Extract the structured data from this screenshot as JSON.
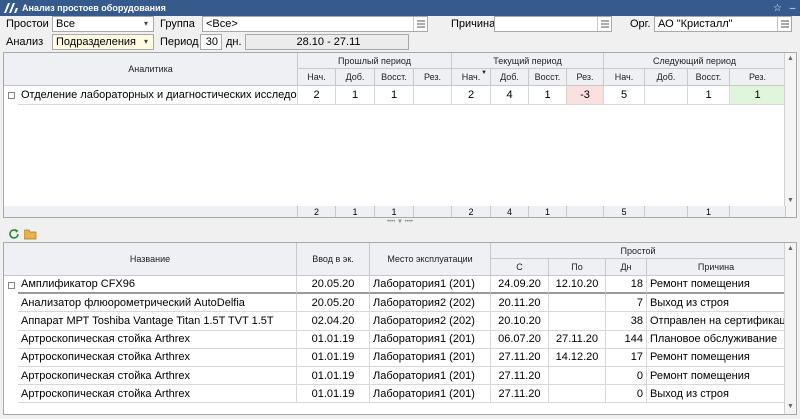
{
  "window": {
    "title": "Анализ простоев оборудования"
  },
  "filters": {
    "downtime_label": "Простои",
    "downtime_value": "Все",
    "group_label": "Группа",
    "group_value": "<Все>",
    "reason_label": "Причина",
    "reason_value": "",
    "org_label": "Орг.",
    "org_value": "АО \"Кристалл\"",
    "analysis_label": "Анализ",
    "analysis_value": "Подразделения",
    "period_label": "Период",
    "period_value": "30",
    "period_unit": "дн.",
    "date_range": "28.10 - 27.11"
  },
  "grid1": {
    "analytics_header": "Аналитика",
    "group_headers": [
      "Прошлый период",
      "Текущий период",
      "Следующий период"
    ],
    "sub_headers": [
      "Нач.",
      "Доб.",
      "Восст.",
      "Рез.",
      "Нач.",
      "Доб.",
      "Восст.",
      "Рез.",
      "Нач.",
      "Доб.",
      "Восст.",
      "Рез."
    ],
    "rows": [
      {
        "name": "Отделение лабораторных и диагностических исследований",
        "values": [
          "2",
          "1",
          "1",
          "",
          "2",
          "4",
          "1",
          "-3",
          "5",
          "",
          "1",
          "1"
        ]
      }
    ],
    "totals": [
      "2",
      "1",
      "1",
      "",
      "2",
      "4",
      "1",
      "",
      "5",
      "",
      "1",
      ""
    ]
  },
  "grid2": {
    "headers": {
      "name": "Название",
      "commission": "Ввод в эк.",
      "location": "Место эксплуатации",
      "downtime_group": "Простой",
      "from": "С",
      "to": "По",
      "days": "Дн",
      "reason": "Причина"
    },
    "rows": [
      {
        "name": "Амплификатор CFX96",
        "commission": "20.05.20",
        "location": "Лаборатория1 (201)",
        "from": "24.09.20",
        "to": "12.10.20",
        "days": "18",
        "reason": "Ремонт помещения"
      },
      {
        "name": "Анализатор флюорометрический AutoDelfia",
        "commission": "20.05.20",
        "location": "Лаборатория2 (202)",
        "from": "20.11.20",
        "to": "",
        "days": "7",
        "reason": "Выход из строя"
      },
      {
        "name": "Аппарат МРТ Toshiba Vantage Titan 1.5T TVT 1.5T",
        "commission": "02.04.20",
        "location": "Лаборатория2 (202)",
        "from": "20.10.20",
        "to": "",
        "days": "38",
        "reason": "Отправлен на сертификацию"
      },
      {
        "name": "Артроскопическая стойка Arthrex",
        "commission": "01.01.19",
        "location": "Лаборатория1 (201)",
        "from": "06.07.20",
        "to": "27.11.20",
        "days": "144",
        "reason": "Плановое обслуживание"
      },
      {
        "name": "Артроскопическая стойка Arthrex",
        "commission": "01.01.19",
        "location": "Лаборатория1 (201)",
        "from": "27.11.20",
        "to": "14.12.20",
        "days": "17",
        "reason": "Ремонт помещения"
      },
      {
        "name": "Артроскопическая стойка Arthrex",
        "commission": "01.01.19",
        "location": "Лаборатория1 (201)",
        "from": "27.11.20",
        "to": "",
        "days": "0",
        "reason": "Ремонт помещения"
      },
      {
        "name": "Артроскопическая стойка Arthrex",
        "commission": "01.01.19",
        "location": "Лаборатория1 (201)",
        "from": "27.11.20",
        "to": "",
        "days": "0",
        "reason": "Выход из строя"
      }
    ]
  },
  "icons": {
    "app_logo": "app-logo-icon",
    "star": "star-icon",
    "minimize": "minimize-icon",
    "refresh": "refresh-icon",
    "folder": "folder-icon"
  },
  "colors": {
    "titlebar": "#365a8c",
    "negative_result": "#fbe0e0",
    "positive_result": "#e1f5dc"
  }
}
